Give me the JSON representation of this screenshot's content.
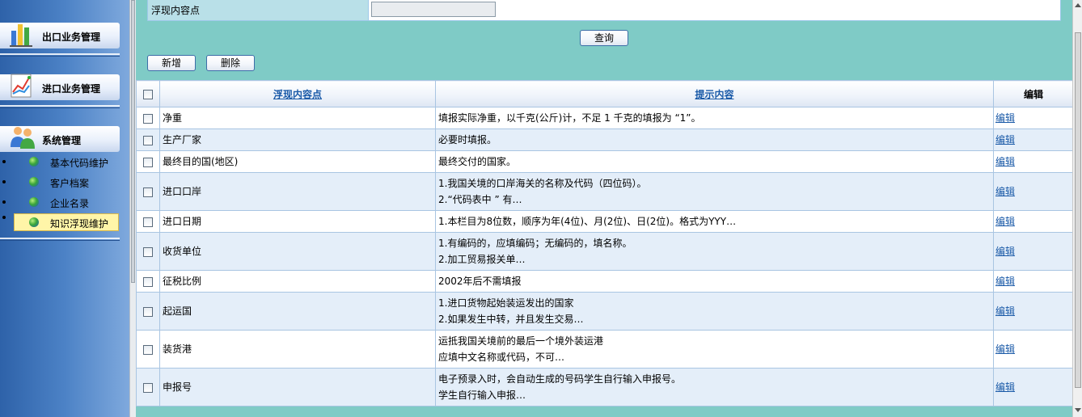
{
  "sidebar": {
    "sections": [
      {
        "label": "出口业务管理",
        "icon": "bar-chart-icon"
      },
      {
        "label": "进口业务管理",
        "icon": "line-chart-icon"
      },
      {
        "label": "系统管理",
        "icon": "users-icon"
      }
    ],
    "items": [
      {
        "label": "基本代码维护"
      },
      {
        "label": "客户档案"
      },
      {
        "label": "企业名录"
      },
      {
        "label": "知识浮现维护"
      }
    ],
    "active_item": "知识浮现维护"
  },
  "search": {
    "label": "浮现内容点",
    "value": "",
    "query_label": "查询"
  },
  "toolbar": {
    "add_label": "新增",
    "delete_label": "删除"
  },
  "table": {
    "headers": {
      "name": "浮现内容点",
      "hint": "提示内容",
      "edit": "编辑"
    },
    "rows": [
      {
        "name": "净重",
        "hint1": "填报实际净重，以千克(公斤)计，不足 1 千克的填报为 “1”。",
        "hint2": "",
        "edit": "编辑"
      },
      {
        "name": "生产厂家",
        "hint1": "必要时填报。",
        "hint2": "",
        "edit": "编辑"
      },
      {
        "name": "最终目的国(地区)",
        "hint1": "最终交付的国家。",
        "hint2": "",
        "edit": "编辑"
      },
      {
        "name": "进口口岸",
        "hint1": "1.我国关境的口岸海关的名称及代码（四位码）。",
        "hint2": "2.“代码表中 ” 有…",
        "edit": "编辑"
      },
      {
        "name": "进口日期",
        "hint1": "1.本栏目为8位数，顺序为年(4位)、月(2位)、日(2位)。格式为YYY…",
        "hint2": "",
        "edit": "编辑"
      },
      {
        "name": "收货单位",
        "hint1": "1.有编码的，应填编码；无编码的，填名称。",
        "hint2": "2.加工贸易报关单…",
        "edit": "编辑"
      },
      {
        "name": "征税比例",
        "hint1": "2002年后不需填报",
        "hint2": "",
        "edit": "编辑"
      },
      {
        "name": "起运国",
        "hint1": "1.进口货物起始装运发出的国家",
        "hint2": "2.如果发生中转，并且发生交易…",
        "edit": "编辑"
      },
      {
        "name": "装货港",
        "hint1": "运抵我国关境前的最后一个境外装运港",
        "hint2": "应填中文名称或代码，不可…",
        "edit": "编辑"
      },
      {
        "name": "申报号",
        "hint1": "电子预录入时，会自动生成的号码学生自行输入申报号。",
        "hint2": "学生自行输入申报…",
        "edit": "编辑"
      }
    ]
  }
}
